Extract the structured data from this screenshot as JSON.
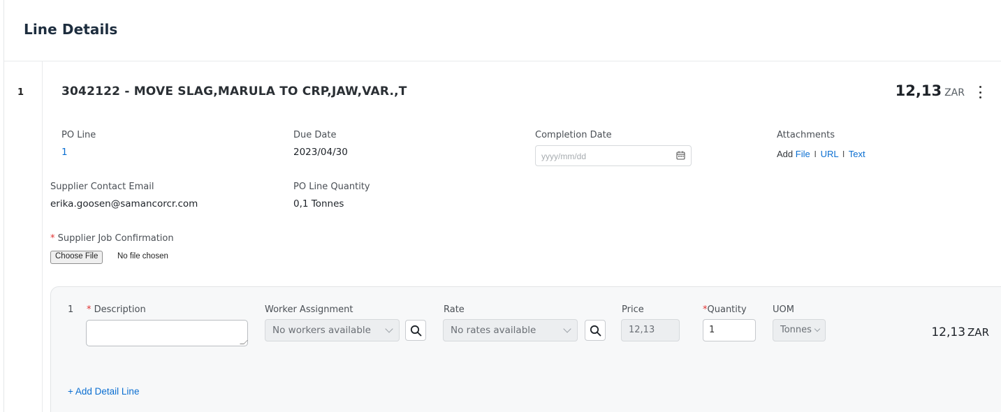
{
  "section": {
    "title": "Line Details"
  },
  "line": {
    "number": "1",
    "heading": "3042122 - MOVE SLAG,MARULA TO CRP,JAW,VAR.,T",
    "total_amount": "12,13",
    "total_currency": "ZAR"
  },
  "fields": {
    "po_line_label": "PO Line",
    "po_line_value": "1",
    "due_date_label": "Due Date",
    "due_date_value": "2023/04/30",
    "completion_date_label": "Completion Date",
    "completion_date_placeholder": "yyyy/mm/dd",
    "attachments_label": "Attachments",
    "attachments_add": "Add",
    "attachments_file": "File",
    "attachments_url": "URL",
    "attachments_text": "Text",
    "attachments_sep": "I",
    "supplier_email_label": "Supplier Contact Email",
    "supplier_email_value": "erika.goosen@samancorcr.com",
    "po_line_qty_label": "PO Line Quantity",
    "po_line_qty_value": "0,1 Tonnes",
    "job_confirmation_label": "Supplier Job Confirmation",
    "required_mark": "*",
    "choose_file_label": "Choose File",
    "no_file_text": "No file chosen"
  },
  "detail": {
    "number": "1",
    "description_label": "Description",
    "worker_label": "Worker Assignment",
    "worker_value": "No workers available",
    "rate_label": "Rate",
    "rate_value": "No rates available",
    "price_label": "Price",
    "price_value": "12,13",
    "quantity_label": "Quantity",
    "quantity_value": "1",
    "uom_label": "UOM",
    "uom_value": "Tonnes",
    "total_amount": "12,13",
    "total_currency": "ZAR",
    "add_line_label": "+ Add Detail Line"
  },
  "colors": {
    "link": "#0a6ed1",
    "required": "#e03131",
    "panel_bg": "#f7f8f9"
  },
  "icons": [
    "more-vertical-icon",
    "calendar-icon",
    "search-icon",
    "chevron-down-icon"
  ]
}
